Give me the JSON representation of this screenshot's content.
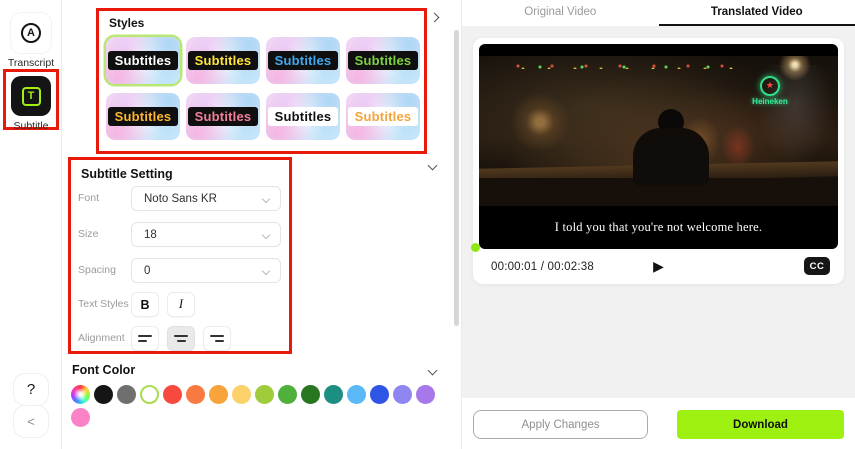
{
  "sidebar": {
    "transcript_label": "Transcript",
    "transcript_icon_letter": "A",
    "subtitle_label": "Subtitle",
    "subtitle_icon_letter": "T",
    "help_label": "?",
    "collapse_label": "<"
  },
  "styles_panel": {
    "title": "Styles",
    "tiles": [
      {
        "label": "Subtitles",
        "color": "#ffffff",
        "pill_bg": "#0f0f0f",
        "selected": true
      },
      {
        "label": "Subtitles",
        "color": "#ffe43a",
        "pill_bg": "#0f0f0f",
        "selected": false
      },
      {
        "label": "Subtitles",
        "color": "#41a8f0",
        "pill_bg": "#0f0f0f",
        "selected": false
      },
      {
        "label": "Subtitles",
        "color": "#7fd33f",
        "pill_bg": "#0f0f0f",
        "selected": false
      },
      {
        "label": "Subtitles",
        "color": "#ffb62e",
        "pill_bg": "#0f0f0f",
        "selected": false
      },
      {
        "label": "Subtitles",
        "color": "#f47f9b",
        "pill_bg": "#0f0f0f",
        "selected": false
      },
      {
        "label": "Subtitles",
        "color": "#101010",
        "pill_bg": "#ffffff",
        "selected": false
      },
      {
        "label": "Subtitles",
        "color": "#f5a33b",
        "pill_bg": "#ffffff",
        "selected": false
      }
    ]
  },
  "subtitle_setting": {
    "title": "Subtitle Setting",
    "font_label": "Font",
    "font_value": "Noto Sans KR",
    "size_label": "Size",
    "size_value": "18",
    "spacing_label": "Spacing",
    "spacing_value": "0",
    "text_styles_label": "Text Styles",
    "bold_label": "B",
    "italic_label": "I",
    "alignment_label": "Alignment",
    "alignment_selected": "center"
  },
  "font_color": {
    "title": "Font Color",
    "selected_swatch": "white",
    "swatches": [
      {
        "name": "rainbow-picker",
        "hex": ""
      },
      {
        "name": "black",
        "hex": "#151515"
      },
      {
        "name": "gray",
        "hex": "#6f6f6f"
      },
      {
        "name": "white",
        "hex": "#ffffff"
      },
      {
        "name": "red",
        "hex": "#f8493f"
      },
      {
        "name": "orange-red",
        "hex": "#f87a40"
      },
      {
        "name": "orange",
        "hex": "#f9a33c"
      },
      {
        "name": "light-yellow",
        "hex": "#fbd169"
      },
      {
        "name": "yellow-green",
        "hex": "#a0cb3a"
      },
      {
        "name": "green",
        "hex": "#4fb13c"
      },
      {
        "name": "dark-green",
        "hex": "#28761f"
      },
      {
        "name": "teal",
        "hex": "#1d8e82"
      },
      {
        "name": "sky-blue",
        "hex": "#5cb9f8"
      },
      {
        "name": "blue",
        "hex": "#2f55e6"
      },
      {
        "name": "periwinkle",
        "hex": "#8f86f2"
      },
      {
        "name": "purple",
        "hex": "#a678ea"
      },
      {
        "name": "pink",
        "hex": "#f983c6"
      }
    ]
  },
  "preview": {
    "tabs": [
      {
        "label": "Original Video",
        "active": false
      },
      {
        "label": "Translated Video",
        "active": true
      }
    ],
    "video": {
      "neon_star": "★",
      "neon_text": "Heineken",
      "subtitle_text": "I told you that you're not welcome here."
    },
    "time_display": "00:00:01 / 00:02:38",
    "play_icon": "▶",
    "cc_label": "CC",
    "apply_label": "Apply Changes",
    "download_label": "Download",
    "accent_green": "#9ef011",
    "annotation_red": "#e8190a"
  }
}
